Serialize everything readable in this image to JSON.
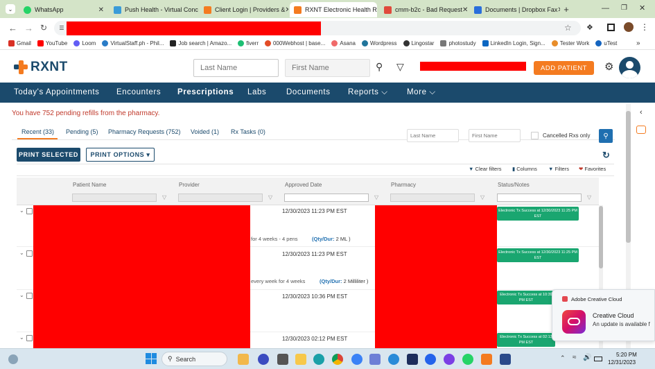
{
  "browser": {
    "tabs": [
      {
        "title": "WhatsApp",
        "color": "#25d366"
      },
      {
        "title": "Push Health - Virtual Conc",
        "color": "#3a9bd8"
      },
      {
        "title": "Client Login | Providers &",
        "color": "#f47b20"
      },
      {
        "title": "RXNT Electronic Health Re",
        "color": "#f47b20"
      },
      {
        "title": "cmm-b2c - Bad Request",
        "color": "#e04a3c"
      },
      {
        "title": "Documents | Dropbox Fax",
        "color": "#2a6edb"
      }
    ],
    "new_tab": "+",
    "bookmarks": [
      {
        "label": "Gmail",
        "color": "#d93025"
      },
      {
        "label": "YouTube",
        "color": "#ff0000"
      },
      {
        "label": "Loom",
        "color": "#625df5"
      },
      {
        "label": "VirtualStaff.ph - Phil...",
        "color": "#2a7cc7"
      },
      {
        "label": "Job search | Amazo...",
        "color": "#222222"
      },
      {
        "label": "fiverr",
        "color": "#1dbf73"
      },
      {
        "label": "000Webhost | base...",
        "color": "#e34c26"
      },
      {
        "label": "Asana",
        "color": "#f06a6a"
      },
      {
        "label": "Wordpress",
        "color": "#21759b"
      },
      {
        "label": "Lingostar",
        "color": "#333333"
      },
      {
        "label": "photostudy",
        "color": "#777777"
      },
      {
        "label": "LinkedIn Login, Sign...",
        "color": "#0a66c2"
      },
      {
        "label": "Tester Work",
        "color": "#e88d2a"
      },
      {
        "label": "uTest",
        "color": "#1565c0"
      }
    ]
  },
  "app": {
    "logo": "RXNT",
    "search_last_placeholder": "Last Name",
    "search_first_placeholder": "First Name",
    "add_patient": "ADD PATIENT"
  },
  "nav": [
    "Today's Appointments",
    "Encounters",
    "Prescriptions",
    "Labs",
    "Documents",
    "Reports ⌵",
    "More ⌵"
  ],
  "content": {
    "notice": "You have 752 pending refills from the pharmacy.",
    "tabs": [
      "Recent (33)",
      "Pending (5)",
      "Pharmacy Requests (752)",
      "Voided (1)",
      "Rx Tasks (0)"
    ],
    "filter_last_placeholder": "Last Name",
    "filter_first_placeholder": "First Name",
    "cancelled_label": "Cancelled Rxs only",
    "print_selected": "PRINT SELECTED",
    "print_options": "PRINT OPTIONS ▾",
    "toolbar": [
      "Clear filters",
      "Columns",
      "Filters",
      "Favorites"
    ],
    "columns": [
      "Patient Name",
      "Provider",
      "Approved Date",
      "Pharmacy",
      "Status/Notes"
    ],
    "rows": [
      {
        "date": "12/30/2023 11:23 PM EST",
        "status": "Electronic Tx Success at 12/30/2023 11:25 PM EST",
        "sig": "for 4 weeks - 4 pens",
        "qty_label": "(Qty/Dur:",
        "qty": "2 ML )"
      },
      {
        "date": "12/30/2023 11:23 PM EST",
        "status": "Electronic Tx Success at 12/30/2023 11:25 PM EST",
        "sig": "every week for 4 weeks",
        "qty_label": "(Qty/Dur:",
        "qty": "2 Milliliter )"
      },
      {
        "date": "12/30/2023 10:36 PM EST",
        "status": "Electronic Tx Success at 10:39 PM EST",
        "sig": "",
        "qty_label": "",
        "qty": ""
      },
      {
        "date": "12/30/2023 02:12 PM EST",
        "status": "Electronic Tx Success at 02:13 PM EST",
        "sig": "",
        "qty_label": "",
        "qty": ""
      }
    ]
  },
  "notification": {
    "app": "Adobe Creative Cloud",
    "title": "Creative Cloud",
    "body": "An update is available f"
  },
  "taskbar": {
    "search": "Search",
    "time": "5:20 PM",
    "date": "12/31/2023"
  }
}
